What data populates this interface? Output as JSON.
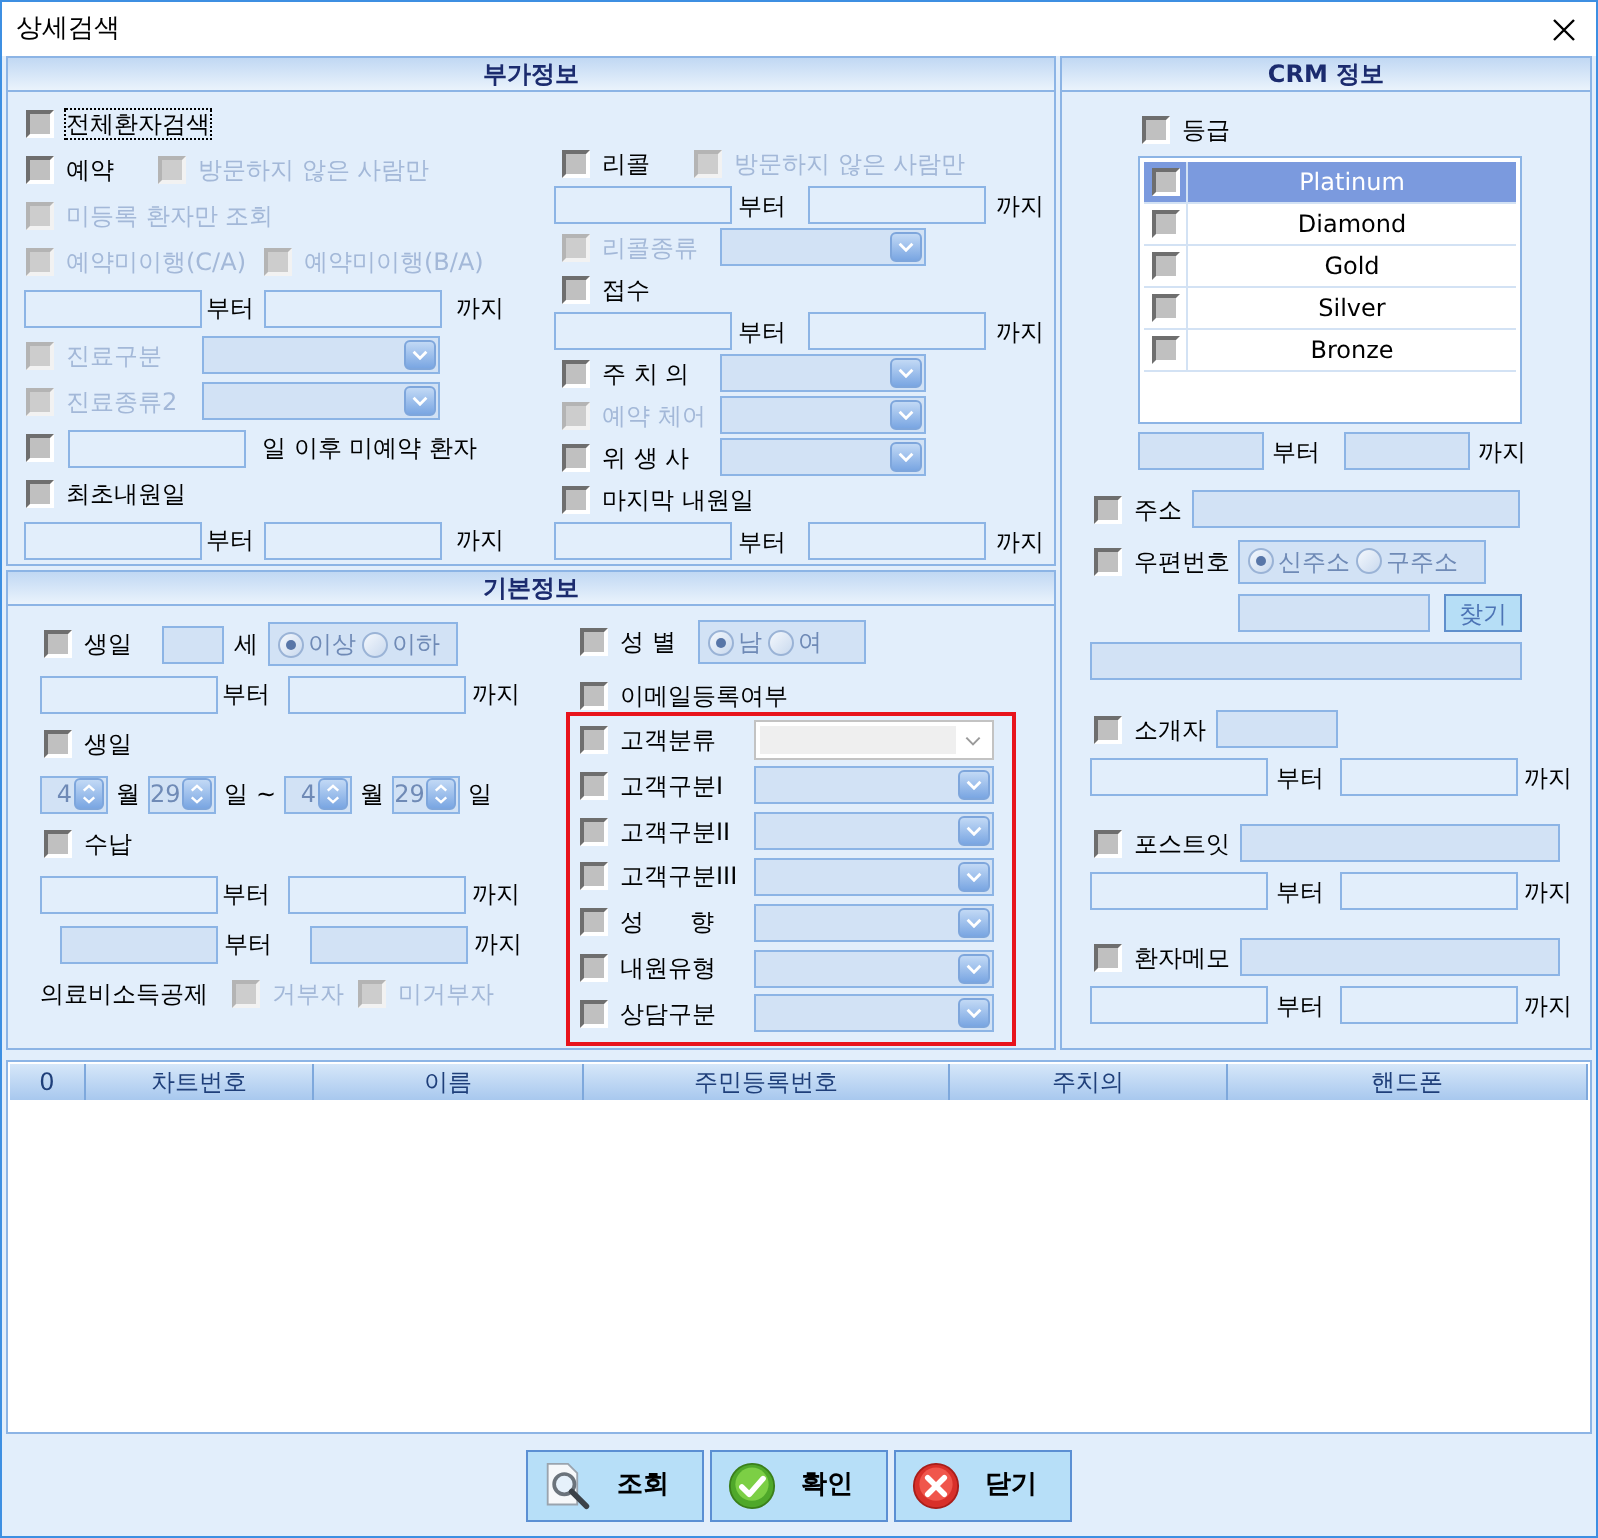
{
  "window": {
    "title": "상세검색"
  },
  "extra_info": {
    "title": "부가정보",
    "left": [
      {
        "kind": "checks",
        "items": [
          {
            "label": "전체환자검색",
            "checked": false,
            "disabled": false,
            "focused": true
          }
        ]
      },
      {
        "kind": "checks",
        "items": [
          {
            "label": "예약",
            "checked": false,
            "disabled": false
          },
          {
            "label": "방문하지 않은 사람만",
            "checked": false,
            "disabled": true
          }
        ]
      },
      {
        "kind": "checks",
        "items": [
          {
            "label": "미등록 환자만 조회",
            "checked": false,
            "disabled": true
          }
        ]
      },
      {
        "kind": "checks",
        "items": [
          {
            "label": "예약미이행(C/A)",
            "checked": false,
            "disabled": true
          },
          {
            "label": "예약미이행(B/A)",
            "checked": false,
            "disabled": true
          }
        ]
      },
      {
        "kind": "range",
        "from": "부터",
        "to": "까지",
        "disabled": false
      },
      {
        "kind": "check_combo",
        "label": "진료구분",
        "checked": false,
        "disabled": true,
        "combo_disabled": true
      },
      {
        "kind": "check_combo",
        "label": "진료종류2",
        "checked": false,
        "disabled": true,
        "combo_disabled": true
      },
      {
        "kind": "check_field_text",
        "text": "일 이후 미예약 환자",
        "checked": false,
        "disabled": false
      },
      {
        "kind": "checks",
        "items": [
          {
            "label": "최초내원일",
            "checked": false,
            "disabled": false
          }
        ]
      },
      {
        "kind": "range",
        "from": "부터",
        "to": "까지",
        "disabled": false
      }
    ],
    "right": [
      {
        "kind": "checks",
        "items": [
          {
            "label": "리콜",
            "checked": false,
            "disabled": false
          },
          {
            "label": "방문하지 않은 사람만",
            "checked": false,
            "disabled": true
          }
        ]
      },
      {
        "kind": "range",
        "from": "부터",
        "to": "까지",
        "disabled": false
      },
      {
        "kind": "check_combo",
        "label": "리콜종류",
        "checked": false,
        "disabled": true,
        "combo_disabled": true
      },
      {
        "kind": "checks",
        "items": [
          {
            "label": "접수",
            "checked": false,
            "disabled": false
          }
        ]
      },
      {
        "kind": "range",
        "from": "부터",
        "to": "까지",
        "disabled": false
      },
      {
        "kind": "check_combo",
        "label": "주 치 의",
        "checked": false,
        "disabled": false,
        "combo_disabled": true
      },
      {
        "kind": "check_combo",
        "label": "예약 체어",
        "checked": false,
        "disabled": true,
        "combo_disabled": true
      },
      {
        "kind": "check_combo",
        "label": "위 생 사",
        "checked": false,
        "disabled": false,
        "combo_disabled": true
      },
      {
        "kind": "checks",
        "items": [
          {
            "label": "마지막 내원일",
            "checked": false,
            "disabled": false
          }
        ]
      },
      {
        "kind": "range",
        "from": "부터",
        "to": "까지",
        "disabled": false
      }
    ]
  },
  "basic_info": {
    "title": "기본정보",
    "left": [
      {
        "kind": "check_age",
        "label": "생일",
        "checked": false,
        "disabled": false,
        "field_disabled": true,
        "unit": "세",
        "radios": {
          "disabled": true,
          "options": [
            {
              "label": "이상",
              "selected": true
            },
            {
              "label": "이하",
              "selected": false
            }
          ]
        }
      },
      {
        "kind": "range",
        "from": "부터",
        "to": "까지",
        "disabled": false
      },
      {
        "kind": "checks",
        "items": [
          {
            "label": "생일",
            "checked": false,
            "disabled": false
          }
        ]
      },
      {
        "kind": "spinners",
        "disabled": true,
        "parts": [
          {
            "kind": "spinner",
            "value": "4"
          },
          {
            "kind": "text",
            "text": "월"
          },
          {
            "kind": "spinner",
            "value": "29"
          },
          {
            "kind": "text",
            "text": "일"
          },
          {
            "kind": "text",
            "text": "~"
          },
          {
            "kind": "spinner",
            "value": "4"
          },
          {
            "kind": "text",
            "text": "월"
          },
          {
            "kind": "spinner",
            "value": "29"
          },
          {
            "kind": "text",
            "text": "일"
          }
        ]
      },
      {
        "kind": "checks",
        "items": [
          {
            "label": "수납",
            "checked": false,
            "disabled": false
          }
        ]
      },
      {
        "kind": "range",
        "from": "부터",
        "to": "까지",
        "disabled": false
      },
      {
        "kind": "range",
        "from": "부터",
        "to": "까지",
        "disabled": true
      },
      {
        "kind": "text_checks",
        "text": "의료비소득공제",
        "items": [
          {
            "label": "거부자",
            "checked": false,
            "disabled": true
          },
          {
            "label": "미거부자",
            "checked": false,
            "disabled": true
          }
        ]
      }
    ],
    "middle": [
      {
        "kind": "check_radios",
        "label": "성 별",
        "checked": false,
        "disabled": false,
        "radios": {
          "disabled": true,
          "options": [
            {
              "label": "남",
              "selected": true
            },
            {
              "label": "여",
              "selected": false
            }
          ]
        }
      },
      {
        "kind": "checks",
        "items": [
          {
            "label": "이메일등록여부",
            "checked": false,
            "disabled": false
          }
        ]
      }
    ],
    "highlighted": [
      {
        "kind": "check_combo",
        "label": "고객분류",
        "checked": false,
        "disabled": false,
        "combo_disabled": false
      },
      {
        "kind": "check_combo",
        "label": "고객구분I",
        "checked": false,
        "disabled": false,
        "combo_disabled": true
      },
      {
        "kind": "check_combo",
        "label": "고객구분II",
        "checked": false,
        "disabled": false,
        "combo_disabled": true
      },
      {
        "kind": "check_combo",
        "label": "고객구분III",
        "checked": false,
        "disabled": false,
        "combo_disabled": true
      },
      {
        "kind": "check_combo",
        "label": "성      향",
        "checked": false,
        "disabled": false,
        "combo_disabled": true
      },
      {
        "kind": "check_combo",
        "label": "내원유형",
        "checked": false,
        "disabled": false,
        "combo_disabled": true
      },
      {
        "kind": "check_combo",
        "label": "상담구분",
        "checked": false,
        "disabled": false,
        "combo_disabled": true
      }
    ]
  },
  "crm": {
    "title": "CRM 정보",
    "sections": [
      {
        "rows": [
          {
            "kind": "checks",
            "items": [
              {
                "label": "등급",
                "checked": false,
                "disabled": false
              }
            ]
          },
          {
            "kind": "grade_list",
            "items": [
              {
                "label": "Platinum",
                "checked": false,
                "selected": true
              },
              {
                "label": "Diamond",
                "checked": false,
                "selected": false
              },
              {
                "label": "Gold",
                "checked": false,
                "selected": false
              },
              {
                "label": "Silver",
                "checked": false,
                "selected": false
              },
              {
                "label": "Bronze",
                "checked": false,
                "selected": false
              }
            ]
          },
          {
            "kind": "range",
            "from": "부터",
            "to": "까지",
            "disabled": true
          }
        ]
      },
      {
        "rows": [
          {
            "kind": "check_field",
            "label": "주소",
            "checked": false,
            "disabled": false,
            "field_disabled": true
          },
          {
            "kind": "check_radios",
            "label": "우편번호",
            "checked": false,
            "disabled": false,
            "radios": {
              "disabled": true,
              "options": [
                {
                  "label": "신주소",
                  "selected": true
                },
                {
                  "label": "구주소",
                  "selected": false
                }
              ]
            }
          },
          {
            "kind": "field_button",
            "field_disabled": true,
            "button": "찾기"
          },
          {
            "kind": "field",
            "disabled": true
          }
        ]
      },
      {
        "rows": [
          {
            "kind": "check_field",
            "label": "소개자",
            "checked": false,
            "disabled": false,
            "field_disabled": true
          },
          {
            "kind": "range",
            "from": "부터",
            "to": "까지",
            "disabled": false
          }
        ]
      },
      {
        "rows": [
          {
            "kind": "check_field",
            "label": "포스트잇",
            "checked": false,
            "disabled": false,
            "field_disabled": true
          },
          {
            "kind": "range",
            "from": "부터",
            "to": "까지",
            "disabled": false
          }
        ]
      },
      {
        "rows": [
          {
            "kind": "check_field",
            "label": "환자메모",
            "checked": false,
            "disabled": false,
            "field_disabled": true
          },
          {
            "kind": "range",
            "from": "부터",
            "to": "까지",
            "disabled": false
          }
        ]
      }
    ]
  },
  "table": {
    "columns": [
      "0",
      "차트번호",
      "이름",
      "주민등록번호",
      "주치의",
      "핸드폰"
    ]
  },
  "buttons": [
    {
      "kind": "search",
      "label": "조회"
    },
    {
      "kind": "confirm",
      "label": "확인"
    },
    {
      "kind": "close",
      "label": "닫기"
    }
  ]
}
